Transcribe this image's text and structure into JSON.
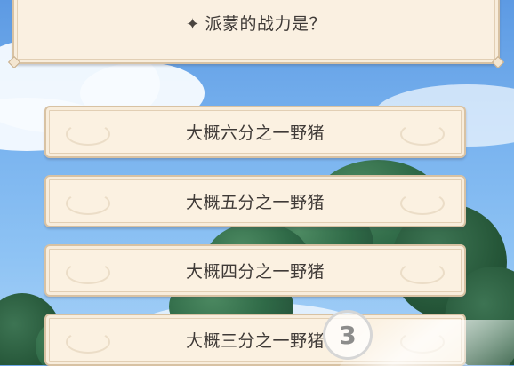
{
  "question": {
    "icon": "sparkle-icon",
    "text": "派蒙的战力是？"
  },
  "options": [
    {
      "label": "大概六分之一野猪"
    },
    {
      "label": "大概五分之一野猪"
    },
    {
      "label": "大概四分之一野猪"
    },
    {
      "label": "大概三分之一野猪"
    }
  ],
  "watermark": {
    "text": "3"
  },
  "colors": {
    "panel_fill": "#fbf1e1",
    "panel_border": "#d8c2a3",
    "text": "#3f3a37",
    "sky": "#79b3ef",
    "foliage": "#2f6a47"
  }
}
